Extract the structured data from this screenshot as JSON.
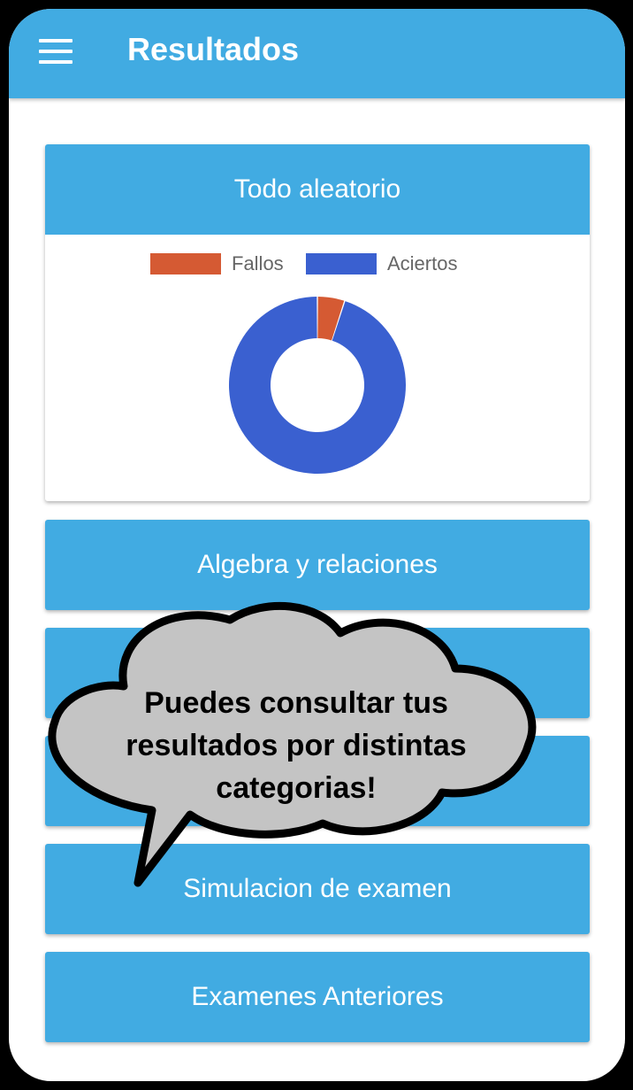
{
  "appbar": {
    "title": "Resultados",
    "menu_icon": "hamburger-menu-icon",
    "color": "#41abe2"
  },
  "main_card": {
    "title": "Todo aleatorio"
  },
  "chart_data": {
    "type": "pie",
    "donut": true,
    "labels": [
      "Fallos",
      "Aciertos"
    ],
    "values": [
      5,
      95
    ],
    "colors": [
      "#d55a33",
      "#3a60d0"
    ],
    "legend_position": "top"
  },
  "categories": [
    "Algebra y relaciones",
    "",
    "",
    "Simulacion de examen",
    "Examenes Anteriores"
  ],
  "tooltip": {
    "line1": "Puedes consultar tus",
    "line2": "resultados por distintas",
    "line3": "categorias!"
  }
}
